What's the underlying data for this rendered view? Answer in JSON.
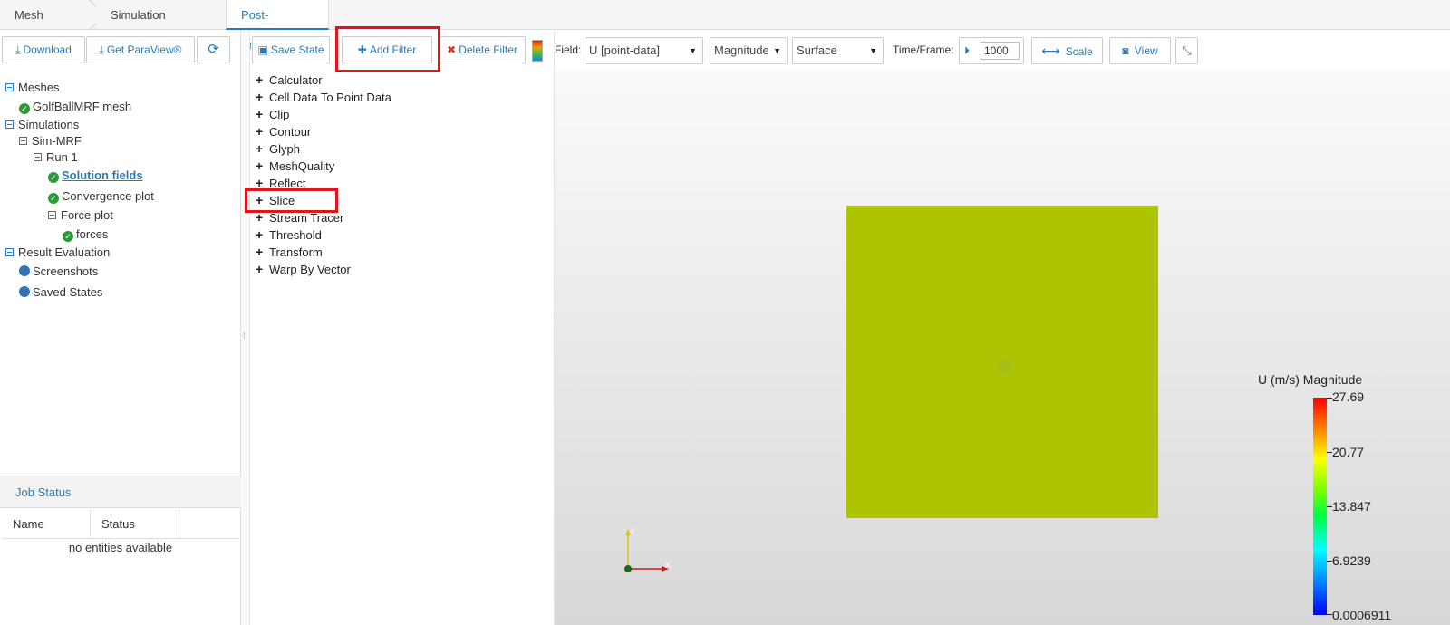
{
  "tabs": [
    {
      "label": "Mesh Creator"
    },
    {
      "label": "Simulation Designer"
    },
    {
      "label": "Post-Processor"
    }
  ],
  "left_toolbar": {
    "download": "Download",
    "paraview": "Get ParaView®"
  },
  "tree": {
    "meshes": "Meshes",
    "mesh_item": "GolfBallMRF mesh",
    "simulations": "Simulations",
    "sim": "Sim-MRF",
    "run": "Run 1",
    "solution_fields": "Solution fields",
    "convergence": "Convergence plot",
    "force_plot": "Force plot",
    "forces": "forces",
    "result_eval": "Result Evaluation",
    "screenshots": "Screenshots",
    "saved_states": "Saved States"
  },
  "job_status": {
    "title": "Job Status",
    "col_name": "Name",
    "col_status": "Status",
    "empty": "no entities available"
  },
  "toolbar": {
    "save_state": "Save State",
    "add_filter": "Add Filter",
    "delete_filter": "Delete Filter",
    "field_label": "Field:",
    "field_value": "U [point-data]",
    "component_value": "Magnitude",
    "representation_value": "Surface",
    "time_label": "Time/Frame:",
    "time_value": "1000",
    "scale": "Scale",
    "view": "View"
  },
  "filters": [
    "Calculator",
    "Cell Data To Point Data",
    "Clip",
    "Contour",
    "Glyph",
    "MeshQuality",
    "Reflect",
    "Slice",
    "Stream Tracer",
    "Threshold",
    "Transform",
    "Warp By Vector"
  ],
  "legend": {
    "title": "U (m/s) Magnitude",
    "ticks": [
      "27.69",
      "20.77",
      "13.847",
      "6.9239",
      "0.0006911"
    ]
  },
  "axes": {
    "y": "Y",
    "x": "X"
  },
  "colors": {
    "accent": "#2a7ab8",
    "highlight_box": "#e0161d",
    "surface": "#aec400"
  }
}
